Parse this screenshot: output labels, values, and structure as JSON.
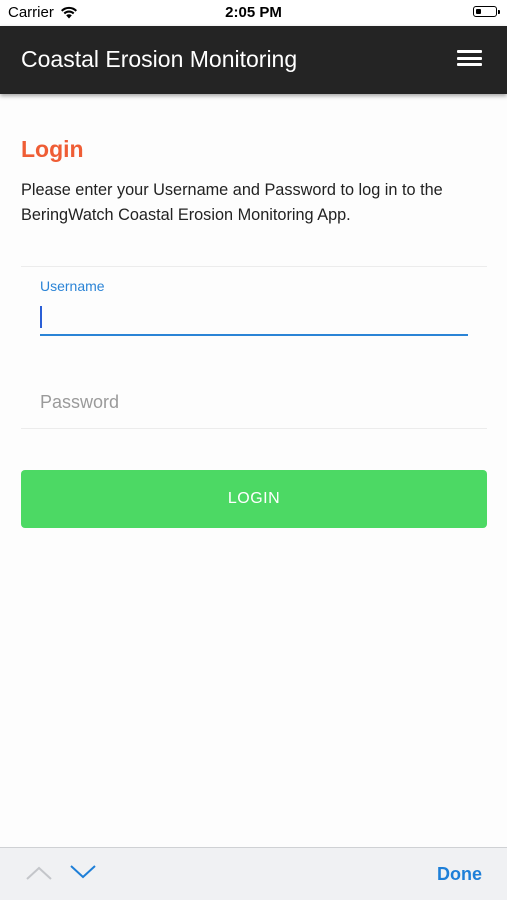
{
  "status_bar": {
    "carrier": "Carrier",
    "time": "2:05 PM",
    "wifi_icon": "wifi-icon",
    "battery_icon": "battery-icon"
  },
  "header": {
    "title": "Coastal Erosion Monitoring",
    "menu_icon": "hamburger-menu-icon",
    "background": "#242424"
  },
  "login": {
    "heading": "Login",
    "heading_color": "#ef5d35",
    "description": "Please enter your Username and Password to log in to the BeringWatch Coastal Erosion Monitoring App.",
    "username": {
      "label": "Username",
      "value": "",
      "focused": true
    },
    "password": {
      "placeholder": "Password",
      "value": ""
    },
    "button_label": "LOGIN",
    "button_color": "#4cd964"
  },
  "accessory_bar": {
    "prev_icon": "chevron-up-icon",
    "next_icon": "chevron-down-icon",
    "done_label": "Done",
    "accent": "#1e7fd8"
  }
}
